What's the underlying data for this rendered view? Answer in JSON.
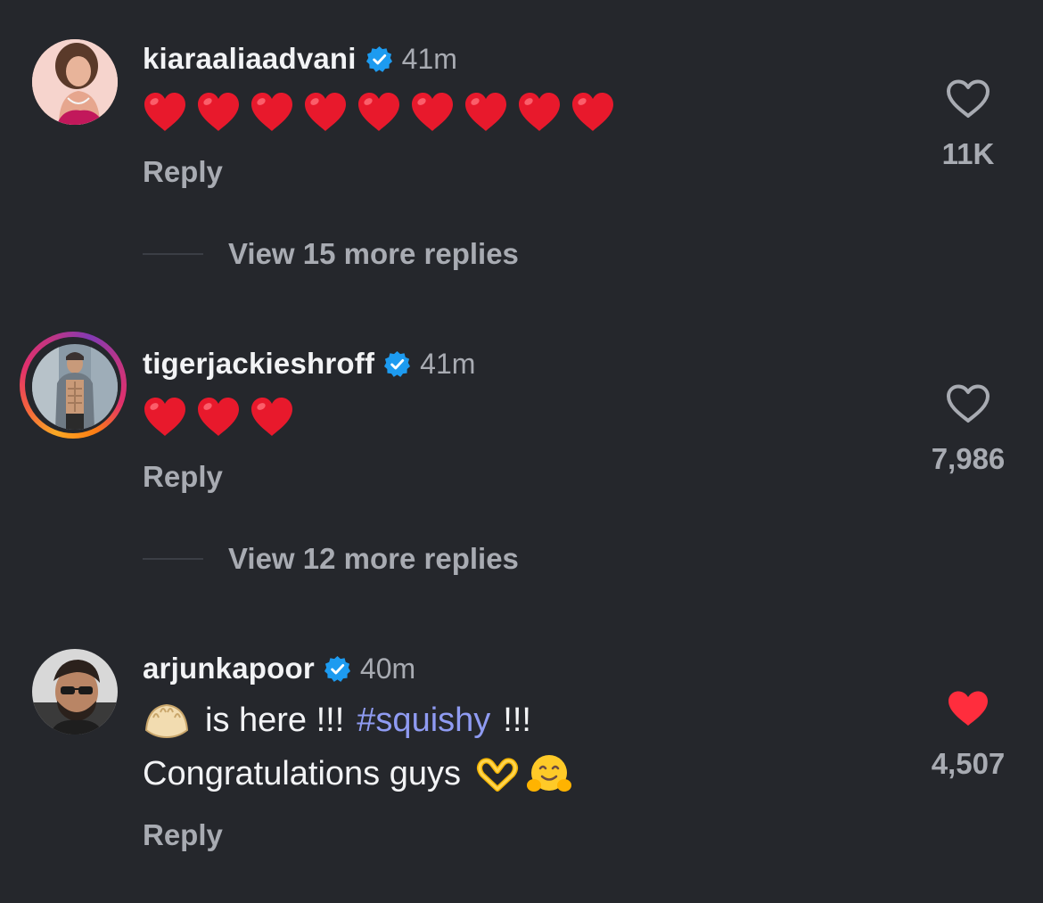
{
  "comments": [
    {
      "username": "kiaraaliaadvani",
      "time": "41m",
      "verified": true,
      "body_hearts": 9,
      "reply_label": "Reply",
      "view_more": "View 15 more replies",
      "likes": "11K",
      "liked": false
    },
    {
      "username": "tigerjackieshroff",
      "time": "41m",
      "verified": true,
      "body_hearts": 3,
      "reply_label": "Reply",
      "view_more": "View 12 more replies",
      "likes": "7,986",
      "liked": false
    },
    {
      "username": "arjunkapoor",
      "time": "40m",
      "verified": true,
      "text_part1": "is here !!!",
      "hashtag": "#squishy",
      "text_part2": "!!!",
      "text_line2": "Congratulations guys",
      "reply_label": "Reply",
      "likes": "4,507",
      "liked": true
    }
  ],
  "icons": {
    "verified": "verified-badge-icon",
    "like_empty": "heart-outline-icon",
    "like_filled": "heart-filled-icon",
    "emoji_heart": "red-heart-emoji",
    "emoji_dumpling": "dumpling-emoji",
    "emoji_heart_hands": "heart-hands-emoji",
    "emoji_hug": "hugging-face-emoji"
  },
  "colors": {
    "background": "#25272c",
    "text_primary": "#f2f3f5",
    "text_secondary": "#a8abb2",
    "hashtag": "#8f9bf2",
    "verified": "#1d9bf0",
    "like_red": "#ff2d3d",
    "emoji_heart": "#e8192c"
  }
}
